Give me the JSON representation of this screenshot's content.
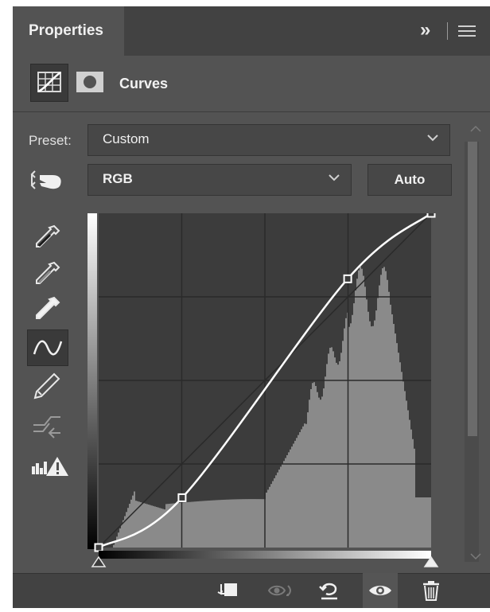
{
  "panel": {
    "tab_label": "Properties",
    "tab_menu_icon": "double-chevron-right-icon",
    "panel_menu_icon": "hamburger-menu-icon"
  },
  "header": {
    "adjustment_icon": "curves-adjustment-icon",
    "mask_icon": "layer-mask-icon",
    "title": "Curves"
  },
  "preset": {
    "label": "Preset:",
    "value": "Custom"
  },
  "channel": {
    "value": "RGB",
    "auto_label": "Auto",
    "targeted_adjust_icon": "targeted-adjustment-hand-icon"
  },
  "tools": [
    {
      "name": "sample-black-point-eyedropper-icon"
    },
    {
      "name": "sample-gray-point-eyedropper-icon"
    },
    {
      "name": "sample-white-point-eyedropper-icon"
    },
    {
      "name": "edit-points-curve-icon",
      "selected": true
    },
    {
      "name": "pencil-draw-icon"
    },
    {
      "name": "smooth-curve-icon"
    },
    {
      "name": "clipping-warning-icon"
    }
  ],
  "curve": {
    "input_range": [
      0,
      255
    ],
    "output_range": [
      0,
      255
    ],
    "points": [
      [
        0,
        0
      ],
      [
        64,
        38
      ],
      [
        191,
        205
      ],
      [
        255,
        255
      ]
    ]
  },
  "histogram": {
    "shown": true
  },
  "bottom_bar": [
    {
      "name": "clip-to-layer-icon"
    },
    {
      "name": "view-previous-state-icon"
    },
    {
      "name": "reset-adjustment-icon"
    },
    {
      "name": "toggle-visibility-eye-icon"
    },
    {
      "name": "delete-adjustment-trash-icon"
    }
  ],
  "colors": {
    "panel_bg": "#535353",
    "tab_bar_bg": "#424242",
    "graph_bg": "#3c3c3c",
    "histogram": "#8a8a8a",
    "curve": "#ffffff"
  }
}
